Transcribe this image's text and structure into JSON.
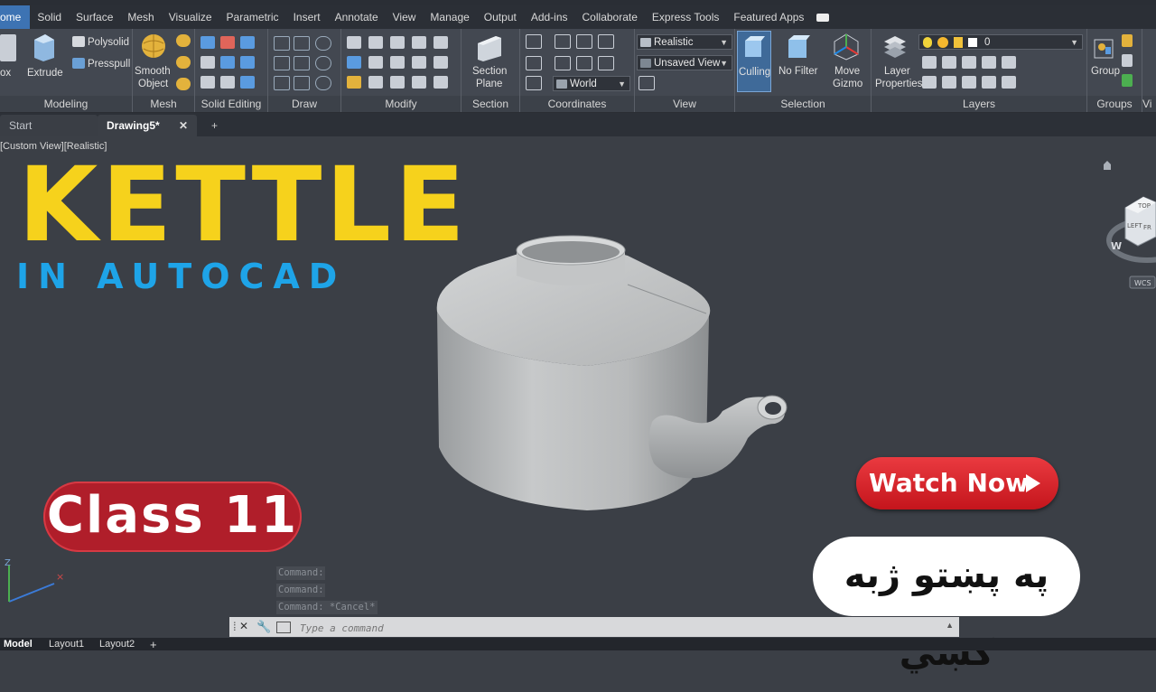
{
  "ribbon_tabs": [
    "ome",
    "Solid",
    "Surface",
    "Mesh",
    "Visualize",
    "Parametric",
    "Insert",
    "Annotate",
    "View",
    "Manage",
    "Output",
    "Add-ins",
    "Collaborate",
    "Express Tools",
    "Featured Apps"
  ],
  "ribbon": {
    "modeling": {
      "title": "Modeling",
      "box": "ox",
      "extrude": "Extrude",
      "polysolid": "Polysolid",
      "presspull": "Presspull"
    },
    "mesh": {
      "title": "Mesh",
      "smooth": "Smooth",
      "object": "Object"
    },
    "solid_editing": {
      "title": "Solid Editing"
    },
    "draw": {
      "title": "Draw"
    },
    "modify": {
      "title": "Modify"
    },
    "section": {
      "title": "Section",
      "plane1": "Section",
      "plane2": "Plane"
    },
    "coordinates": {
      "title": "Coordinates",
      "world": "World"
    },
    "view": {
      "title": "View",
      "visual_style": "Realistic",
      "named_view": "Unsaved View"
    },
    "selection": {
      "title": "Selection",
      "culling": "Culling",
      "nofilter": "No Filter",
      "gizmo1": "Move",
      "gizmo2": "Gizmo"
    },
    "layers": {
      "title": "Layers",
      "props1": "Layer",
      "props2": "Properties",
      "current": "0"
    },
    "groups": {
      "title": "Groups",
      "group": "Group"
    },
    "vi": {
      "label": "Vi"
    }
  },
  "file_tabs": {
    "start": "Start",
    "drawing": "Drawing5*",
    "close": "✕",
    "add": "+"
  },
  "viewport_label": "[Custom View][Realistic]",
  "viewcube": {
    "top": "TOP",
    "left": "LEFT",
    "front": "FR",
    "compass": "W",
    "wcs": "WCS"
  },
  "overlay": {
    "title": "KETTLE",
    "subtitle": "IN AUTOCAD",
    "class_badge": "Class 11",
    "watch_now": "Watch Now",
    "pashto": "په پښتو ژبه کښي"
  },
  "command_history": [
    "Command:",
    "Command:",
    "Command: *Cancel*"
  ],
  "command_input_placeholder": "Type a command",
  "layout_tabs": [
    "Model",
    "Layout1",
    "Layout2"
  ],
  "colors": {
    "accent": "#3d73b3",
    "title_yellow": "#f6d21c",
    "sub_blue": "#1ea4e8",
    "badge_red": "#b01e2a"
  }
}
